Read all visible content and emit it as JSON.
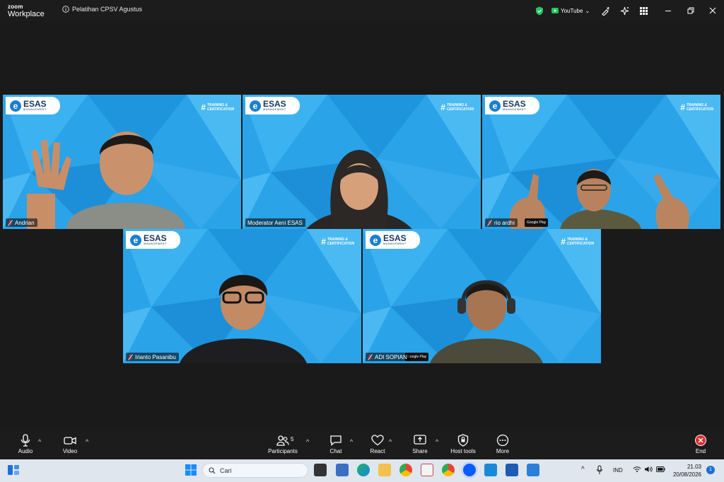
{
  "app": {
    "brand_line1": "zoom",
    "brand_line2": "Workplace",
    "meeting_title": "Pelatihan CPSV Agustus"
  },
  "titlebar_right": {
    "app_label": "YouTube"
  },
  "tile_branding": {
    "logo_text": "ESAS",
    "logo_sub": "MANAGEMENT",
    "cert_line1": "TRAINING &",
    "cert_line2": "CERTIFICATION",
    "store_badge": "Google Play"
  },
  "participants": [
    {
      "name": "Andrian",
      "muted": true
    },
    {
      "name": "Moderator Aeni ESAS",
      "muted": false,
      "active_speaker": true
    },
    {
      "name": "rio ardhi",
      "muted": true
    },
    {
      "name": "Irianto Pasanibu",
      "muted": true
    },
    {
      "name": "ADI SOPIAN",
      "muted": true
    }
  ],
  "toolbar": {
    "audio": "Audio",
    "video": "Video",
    "participants": "Participants",
    "participant_count": "5",
    "chat": "Chat",
    "react": "React",
    "share": "Share",
    "host_tools": "Host tools",
    "more": "More",
    "end": "End"
  },
  "taskbar": {
    "search_placeholder": "Cari",
    "language": "IND",
    "time": "21.03",
    "date": "20/08/2026",
    "notification_count": "1"
  },
  "colors": {
    "tile_blue": "#2aa3e8",
    "active_border": "#22d36b",
    "end_red": "#e02b2b",
    "shield_green": "#22c55e"
  }
}
